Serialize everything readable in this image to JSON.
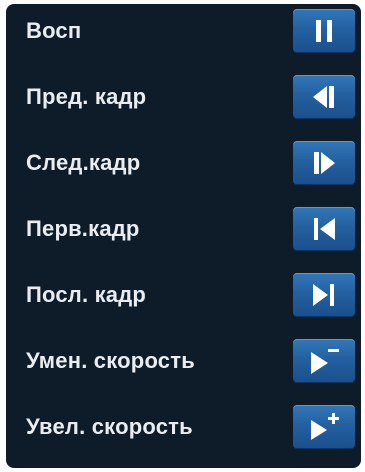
{
  "playback_controls": {
    "items": [
      {
        "label": "Восп",
        "icon": "pause-icon"
      },
      {
        "label": "Пред. кадр",
        "icon": "previous-frame-icon"
      },
      {
        "label": "След.кадр",
        "icon": "next-frame-icon"
      },
      {
        "label": "Перв.кадр",
        "icon": "first-frame-icon"
      },
      {
        "label": "Посл. кадр",
        "icon": "last-frame-icon"
      },
      {
        "label": "Умен. скорость",
        "icon": "decrease-speed-icon"
      },
      {
        "label": "Увел. скорость",
        "icon": "increase-speed-icon"
      }
    ]
  },
  "colors": {
    "panel_background": "#0d1c28",
    "label_text": "#e9edf1",
    "button_blue": "#2460a0",
    "icon_white": "#ffffff"
  }
}
